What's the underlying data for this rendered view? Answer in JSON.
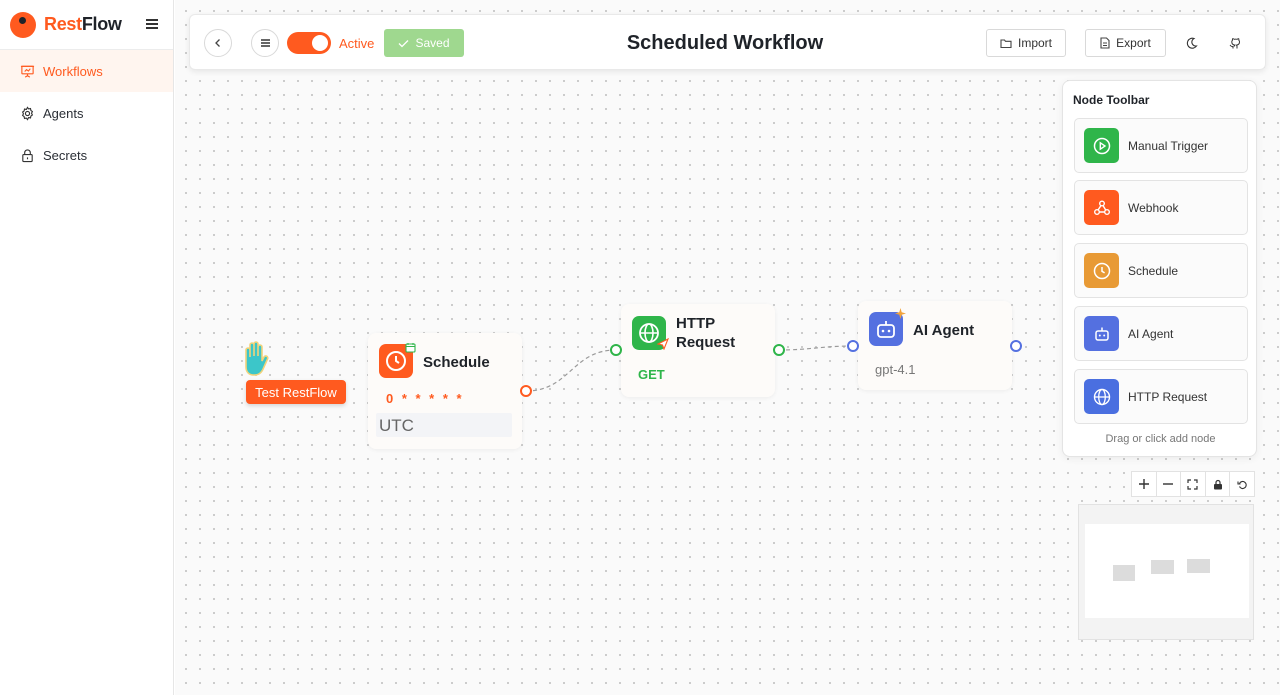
{
  "app": {
    "brand_rest": "Rest",
    "brand_flow": "Flow"
  },
  "sidebar": {
    "items": [
      {
        "label": "Workflows",
        "icon": "presentation-icon",
        "active": true
      },
      {
        "label": "Agents",
        "icon": "gear-icon",
        "active": false
      },
      {
        "label": "Secrets",
        "icon": "lock-icon",
        "active": false
      }
    ]
  },
  "topbar": {
    "active_label": "Active",
    "active_on": true,
    "saved_label": "Saved",
    "title": "Scheduled Workflow",
    "import_label": "Import",
    "export_label": "Export"
  },
  "canvas": {
    "test_button": "Test RestFlow",
    "nodes": {
      "schedule": {
        "title": "Schedule",
        "cron": "0 * * * * *",
        "timezone": "UTC"
      },
      "http": {
        "title": "HTTP Request",
        "method": "GET"
      },
      "agent": {
        "title": "AI Agent",
        "model": "gpt-4.1"
      }
    }
  },
  "toolbar": {
    "title": "Node Toolbar",
    "items": [
      {
        "label": "Manual Trigger",
        "icon": "play-icon",
        "color": "#2fb54a"
      },
      {
        "label": "Webhook",
        "icon": "webhook-icon",
        "color": "#ff5a1f"
      },
      {
        "label": "Schedule",
        "icon": "clock-icon",
        "color": "#e89a35"
      },
      {
        "label": "AI Agent",
        "icon": "robot-icon",
        "color": "#5470e0"
      },
      {
        "label": "HTTP Request",
        "icon": "globe-icon",
        "color": "#4a6fe0"
      }
    ],
    "hint": "Drag or click add node"
  },
  "colors": {
    "accent": "#ff5a1f",
    "saved": "#9fd88f",
    "http": "#2fb54a",
    "agent": "#5470e0"
  }
}
